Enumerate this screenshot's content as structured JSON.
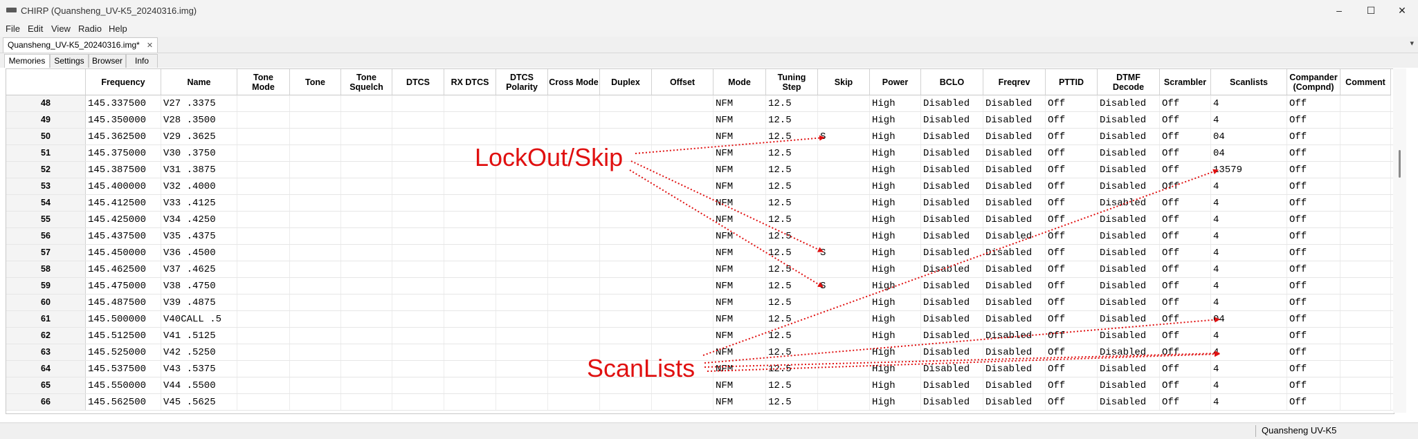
{
  "window": {
    "title": "CHIRP (Quansheng_UV-K5_20240316.img)",
    "controls": {
      "minimize": "–",
      "maximize": "☐",
      "close": "✕"
    }
  },
  "menubar": {
    "items": [
      "File",
      "Edit",
      "View",
      "Radio",
      "Help"
    ]
  },
  "file_tab": {
    "label": "Quansheng_UV-K5_20240316.img*",
    "close": "✕"
  },
  "notebook_chevron": "▾",
  "subtabs": [
    "Memories",
    "Settings",
    "Browser",
    "Info"
  ],
  "table": {
    "columns": [
      {
        "key": "frequency",
        "label": "Frequency"
      },
      {
        "key": "name",
        "label": "Name"
      },
      {
        "key": "tone_mode",
        "label": "Tone\nMode"
      },
      {
        "key": "tone",
        "label": "Tone"
      },
      {
        "key": "tone_squelch",
        "label": "Tone\nSquelch"
      },
      {
        "key": "dtcs",
        "label": "DTCS"
      },
      {
        "key": "rx_dtcs",
        "label": "RX DTCS"
      },
      {
        "key": "dtcs_polarity",
        "label": "DTCS\nPolarity"
      },
      {
        "key": "cross_mode",
        "label": "Cross Mode"
      },
      {
        "key": "duplex",
        "label": "Duplex"
      },
      {
        "key": "offset",
        "label": "Offset"
      },
      {
        "key": "mode",
        "label": "Mode"
      },
      {
        "key": "tuning_step",
        "label": "Tuning\nStep"
      },
      {
        "key": "skip",
        "label": "Skip"
      },
      {
        "key": "power",
        "label": "Power"
      },
      {
        "key": "bclo",
        "label": "BCLO"
      },
      {
        "key": "freqrev",
        "label": "Freqrev"
      },
      {
        "key": "pttid",
        "label": "PTTID"
      },
      {
        "key": "dtmf_decode",
        "label": "DTMF\nDecode"
      },
      {
        "key": "scrambler",
        "label": "Scrambler"
      },
      {
        "key": "scanlists",
        "label": "Scanlists"
      },
      {
        "key": "compander",
        "label": "Compander\n(Compnd)"
      },
      {
        "key": "comment",
        "label": "Comment"
      }
    ],
    "rows": [
      {
        "num": "48",
        "frequency": "145.337500",
        "name": "V27 .3375",
        "mode": "NFM",
        "tuning_step": "12.5",
        "skip": "",
        "power": "High",
        "bclo": "Disabled",
        "freqrev": "Disabled",
        "pttid": "Off",
        "dtmf_decode": "Disabled",
        "scrambler": "Off",
        "scanlists": "4",
        "compander": "Off"
      },
      {
        "num": "49",
        "frequency": "145.350000",
        "name": "V28 .3500",
        "mode": "NFM",
        "tuning_step": "12.5",
        "skip": "",
        "power": "High",
        "bclo": "Disabled",
        "freqrev": "Disabled",
        "pttid": "Off",
        "dtmf_decode": "Disabled",
        "scrambler": "Off",
        "scanlists": "4",
        "compander": "Off"
      },
      {
        "num": "50",
        "frequency": "145.362500",
        "name": "V29 .3625",
        "mode": "NFM",
        "tuning_step": "12.5",
        "skip": "S",
        "power": "High",
        "bclo": "Disabled",
        "freqrev": "Disabled",
        "pttid": "Off",
        "dtmf_decode": "Disabled",
        "scrambler": "Off",
        "scanlists": "04",
        "compander": "Off"
      },
      {
        "num": "51",
        "frequency": "145.375000",
        "name": "V30 .3750",
        "mode": "NFM",
        "tuning_step": "12.5",
        "skip": "",
        "power": "High",
        "bclo": "Disabled",
        "freqrev": "Disabled",
        "pttid": "Off",
        "dtmf_decode": "Disabled",
        "scrambler": "Off",
        "scanlists": "04",
        "compander": "Off"
      },
      {
        "num": "52",
        "frequency": "145.387500",
        "name": "V31 .3875",
        "mode": "NFM",
        "tuning_step": "12.5",
        "skip": "",
        "power": "High",
        "bclo": "Disabled",
        "freqrev": "Disabled",
        "pttid": "Off",
        "dtmf_decode": "Disabled",
        "scrambler": "Off",
        "scanlists": "13579",
        "compander": "Off"
      },
      {
        "num": "53",
        "frequency": "145.400000",
        "name": "V32 .4000",
        "mode": "NFM",
        "tuning_step": "12.5",
        "skip": "",
        "power": "High",
        "bclo": "Disabled",
        "freqrev": "Disabled",
        "pttid": "Off",
        "dtmf_decode": "Disabled",
        "scrambler": "Off",
        "scanlists": "4",
        "compander": "Off"
      },
      {
        "num": "54",
        "frequency": "145.412500",
        "name": "V33 .4125",
        "mode": "NFM",
        "tuning_step": "12.5",
        "skip": "",
        "power": "High",
        "bclo": "Disabled",
        "freqrev": "Disabled",
        "pttid": "Off",
        "dtmf_decode": "Disabled",
        "scrambler": "Off",
        "scanlists": "4",
        "compander": "Off"
      },
      {
        "num": "55",
        "frequency": "145.425000",
        "name": "V34 .4250",
        "mode": "NFM",
        "tuning_step": "12.5",
        "skip": "",
        "power": "High",
        "bclo": "Disabled",
        "freqrev": "Disabled",
        "pttid": "Off",
        "dtmf_decode": "Disabled",
        "scrambler": "Off",
        "scanlists": "4",
        "compander": "Off"
      },
      {
        "num": "56",
        "frequency": "145.437500",
        "name": "V35 .4375",
        "mode": "NFM",
        "tuning_step": "12.5",
        "skip": "",
        "power": "High",
        "bclo": "Disabled",
        "freqrev": "Disabled",
        "pttid": "Off",
        "dtmf_decode": "Disabled",
        "scrambler": "Off",
        "scanlists": "4",
        "compander": "Off"
      },
      {
        "num": "57",
        "frequency": "145.450000",
        "name": "V36 .4500",
        "mode": "NFM",
        "tuning_step": "12.5",
        "skip": "S",
        "power": "High",
        "bclo": "Disabled",
        "freqrev": "Disabled",
        "pttid": "Off",
        "dtmf_decode": "Disabled",
        "scrambler": "Off",
        "scanlists": "4",
        "compander": "Off"
      },
      {
        "num": "58",
        "frequency": "145.462500",
        "name": "V37 .4625",
        "mode": "NFM",
        "tuning_step": "12.5",
        "skip": "",
        "power": "High",
        "bclo": "Disabled",
        "freqrev": "Disabled",
        "pttid": "Off",
        "dtmf_decode": "Disabled",
        "scrambler": "Off",
        "scanlists": "4",
        "compander": "Off"
      },
      {
        "num": "59",
        "frequency": "145.475000",
        "name": "V38 .4750",
        "mode": "NFM",
        "tuning_step": "12.5",
        "skip": "S",
        "power": "High",
        "bclo": "Disabled",
        "freqrev": "Disabled",
        "pttid": "Off",
        "dtmf_decode": "Disabled",
        "scrambler": "Off",
        "scanlists": "4",
        "compander": "Off"
      },
      {
        "num": "60",
        "frequency": "145.487500",
        "name": "V39 .4875",
        "mode": "NFM",
        "tuning_step": "12.5",
        "skip": "",
        "power": "High",
        "bclo": "Disabled",
        "freqrev": "Disabled",
        "pttid": "Off",
        "dtmf_decode": "Disabled",
        "scrambler": "Off",
        "scanlists": "4",
        "compander": "Off"
      },
      {
        "num": "61",
        "frequency": "145.500000",
        "name": "V40CALL .5",
        "mode": "NFM",
        "tuning_step": "12.5",
        "skip": "",
        "power": "High",
        "bclo": "Disabled",
        "freqrev": "Disabled",
        "pttid": "Off",
        "dtmf_decode": "Disabled",
        "scrambler": "Off",
        "scanlists": "04",
        "compander": "Off"
      },
      {
        "num": "62",
        "frequency": "145.512500",
        "name": "V41 .5125",
        "mode": "NFM",
        "tuning_step": "12.5",
        "skip": "",
        "power": "High",
        "bclo": "Disabled",
        "freqrev": "Disabled",
        "pttid": "Off",
        "dtmf_decode": "Disabled",
        "scrambler": "Off",
        "scanlists": "4",
        "compander": "Off"
      },
      {
        "num": "63",
        "frequency": "145.525000",
        "name": "V42 .5250",
        "mode": "NFM",
        "tuning_step": "12.5",
        "skip": "",
        "power": "High",
        "bclo": "Disabled",
        "freqrev": "Disabled",
        "pttid": "Off",
        "dtmf_decode": "Disabled",
        "scrambler": "Off",
        "scanlists": "4",
        "compander": "Off"
      },
      {
        "num": "64",
        "frequency": "145.537500",
        "name": "V43 .5375",
        "mode": "NFM",
        "tuning_step": "12.5",
        "skip": "",
        "power": "High",
        "bclo": "Disabled",
        "freqrev": "Disabled",
        "pttid": "Off",
        "dtmf_decode": "Disabled",
        "scrambler": "Off",
        "scanlists": "4",
        "compander": "Off"
      },
      {
        "num": "65",
        "frequency": "145.550000",
        "name": "V44 .5500",
        "mode": "NFM",
        "tuning_step": "12.5",
        "skip": "",
        "power": "High",
        "bclo": "Disabled",
        "freqrev": "Disabled",
        "pttid": "Off",
        "dtmf_decode": "Disabled",
        "scrambler": "Off",
        "scanlists": "4",
        "compander": "Off"
      },
      {
        "num": "66",
        "frequency": "145.562500",
        "name": "V45 .5625",
        "mode": "NFM",
        "tuning_step": "12.5",
        "skip": "",
        "power": "High",
        "bclo": "Disabled",
        "freqrev": "Disabled",
        "pttid": "Off",
        "dtmf_decode": "Disabled",
        "scrambler": "Off",
        "scanlists": "4",
        "compander": "Off"
      }
    ]
  },
  "annotations": {
    "lockout_label": "LockOut/Skip",
    "scanlists_label": "ScanLists",
    "color": "#e01010"
  },
  "statusbar": {
    "radio": "Quansheng UV-K5"
  }
}
